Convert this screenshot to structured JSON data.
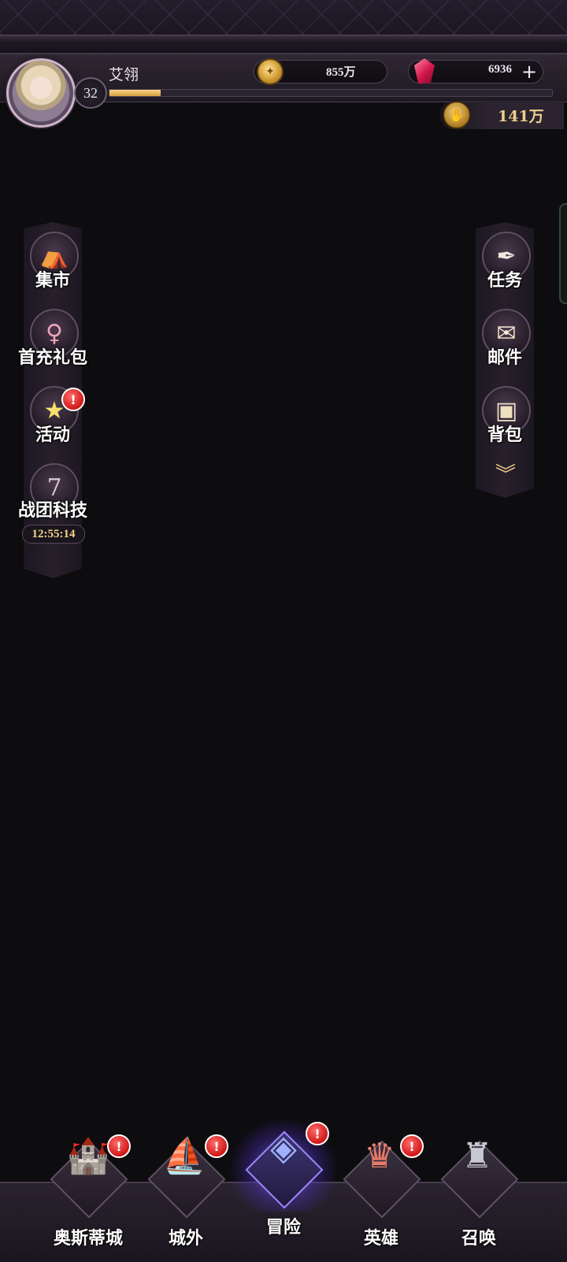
{
  "player": {
    "name": "艾翎",
    "level": "32",
    "exp_fraction": 0.115
  },
  "resources": {
    "gold": "855万",
    "gems": "6936",
    "gems_add": "+",
    "tickets": "141万"
  },
  "left_menu": {
    "items": [
      {
        "label": "集市",
        "icon": "market-stall-icon"
      },
      {
        "label": "首充礼包",
        "icon": "girl-portrait-icon"
      },
      {
        "label": "活动",
        "icon": "star-icon",
        "badge": "!"
      },
      {
        "label": "战团科技",
        "icon": "laurel-seven-icon",
        "timer": "12:55:14"
      }
    ]
  },
  "right_menu": {
    "items": [
      {
        "label": "任务",
        "icon": "quill-scroll-icon"
      },
      {
        "label": "邮件",
        "icon": "envelope-icon"
      },
      {
        "label": "背包",
        "icon": "backpack-icon"
      }
    ],
    "expand_icon": "chevron-double-down-icon"
  },
  "bottom_nav": {
    "items": [
      {
        "label": "奥斯蒂城",
        "icon": "city-icon",
        "badge": "!"
      },
      {
        "label": "城外",
        "icon": "airship-icon",
        "badge": "!"
      },
      {
        "label": "冒险",
        "icon": "portal-icon",
        "badge": "!",
        "active": true
      },
      {
        "label": "英雄",
        "icon": "heroine-icon",
        "badge": "!"
      },
      {
        "label": "召唤",
        "icon": "angel-statue-icon"
      }
    ]
  },
  "colors": {
    "background": "#0d0c0e",
    "gold_text": "#f0cf8a",
    "exp_bar": "#e6b050",
    "badge_red": "#d01818",
    "active_glow": "#8c6eff"
  }
}
